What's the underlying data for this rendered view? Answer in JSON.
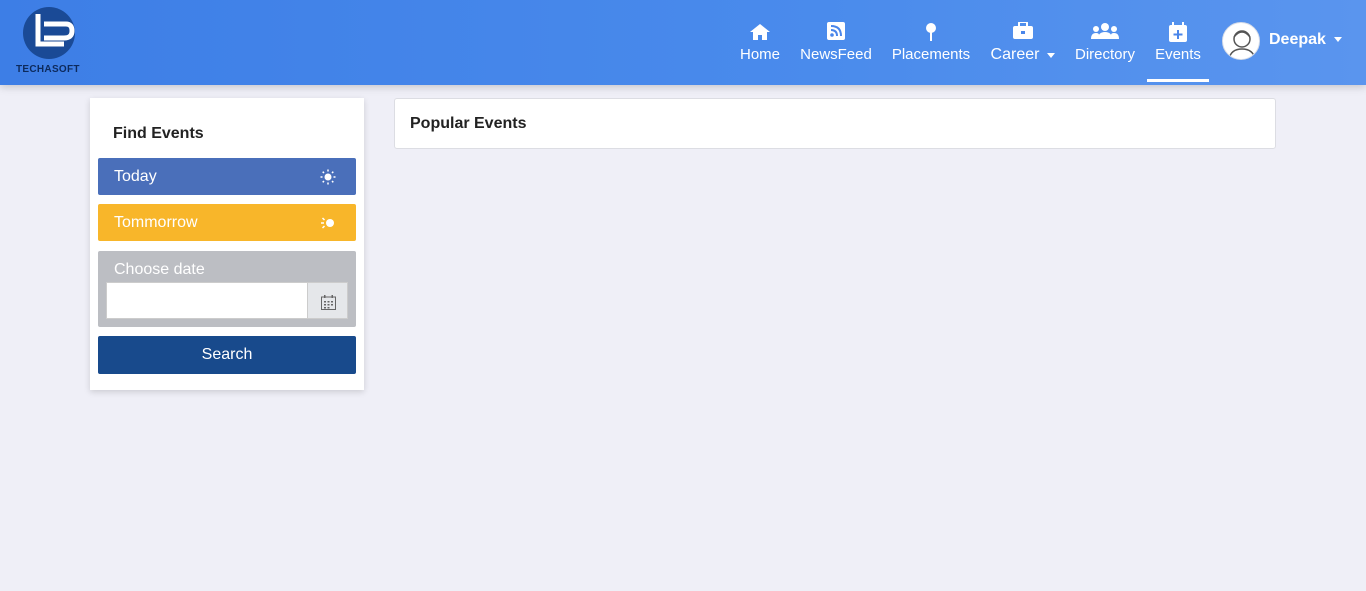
{
  "brand": {
    "name": "TECHASOFT",
    "colors": {
      "navbar": "#3d7ee6",
      "today": "#4a6fba",
      "tomorrow": "#f8b62a",
      "search": "#184a8c",
      "date_box": "#bcbec3"
    }
  },
  "nav": {
    "items": [
      {
        "label": "Home",
        "icon": "home-icon"
      },
      {
        "label": "NewsFeed",
        "icon": "rss-icon"
      },
      {
        "label": "Placements",
        "icon": "map-pin-icon"
      },
      {
        "label": "Career",
        "icon": "briefcase-icon"
      },
      {
        "label": "Directory",
        "icon": "users-icon"
      },
      {
        "label": "Events",
        "icon": "calendar-plus-icon",
        "active": true
      }
    ],
    "user": {
      "name": "Deepak",
      "icon": "user-avatar-icon"
    }
  },
  "sidebar": {
    "title": "Find Events",
    "today": {
      "label": "Today",
      "icon": "sun-icon"
    },
    "tomorrow": {
      "label": "Tommorrow",
      "icon": "sunrise-icon"
    },
    "date": {
      "label": "Choose date",
      "value": "",
      "placeholder": "",
      "icon": "calendar-icon"
    },
    "search_label": "Search"
  },
  "main": {
    "popular_title": "Popular Events"
  }
}
